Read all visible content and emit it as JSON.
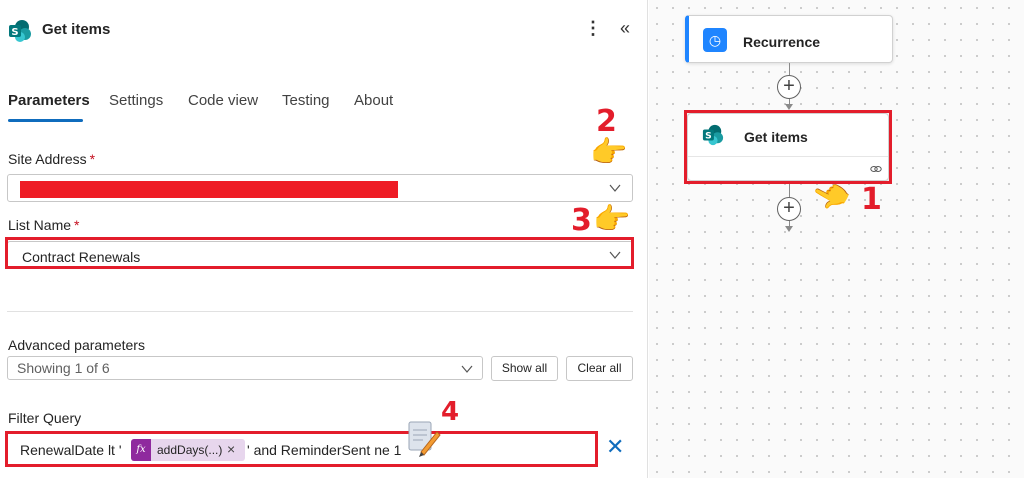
{
  "header": {
    "title": "Get items",
    "more_icon": "⋮",
    "collapse_icon": "«"
  },
  "tabs": [
    {
      "label": "Parameters",
      "active": true
    },
    {
      "label": "Settings",
      "active": false
    },
    {
      "label": "Code view",
      "active": false
    },
    {
      "label": "Testing",
      "active": false
    },
    {
      "label": "About",
      "active": false
    }
  ],
  "site_address": {
    "label": "Site Address",
    "required_mark": "*",
    "value_redacted": true
  },
  "list_name": {
    "label": "List Name",
    "required_mark": "*",
    "value": "Contract Renewals"
  },
  "advanced": {
    "label": "Advanced parameters",
    "selected": "Showing 1 of 6",
    "show_all": "Show all",
    "clear_all": "Clear all"
  },
  "filter": {
    "label": "Filter Query",
    "prefix": "RenewalDate lt '",
    "token_label": "addDays(...)",
    "token_icon": "fx",
    "suffix": "' and ReminderSent ne 1",
    "clear_icon": "✕"
  },
  "annotations": {
    "n1": "1",
    "n2": "2",
    "n3": "3",
    "n4": "4"
  },
  "flow": {
    "trigger_title": "Recurrence",
    "action_title": "Get items",
    "plus_symbol": "+"
  },
  "colors": {
    "highlight": "#e31d2b",
    "accent": "#0f6cbd",
    "fx_token": "#8f2a9e",
    "sharepoint": "#036c70"
  }
}
